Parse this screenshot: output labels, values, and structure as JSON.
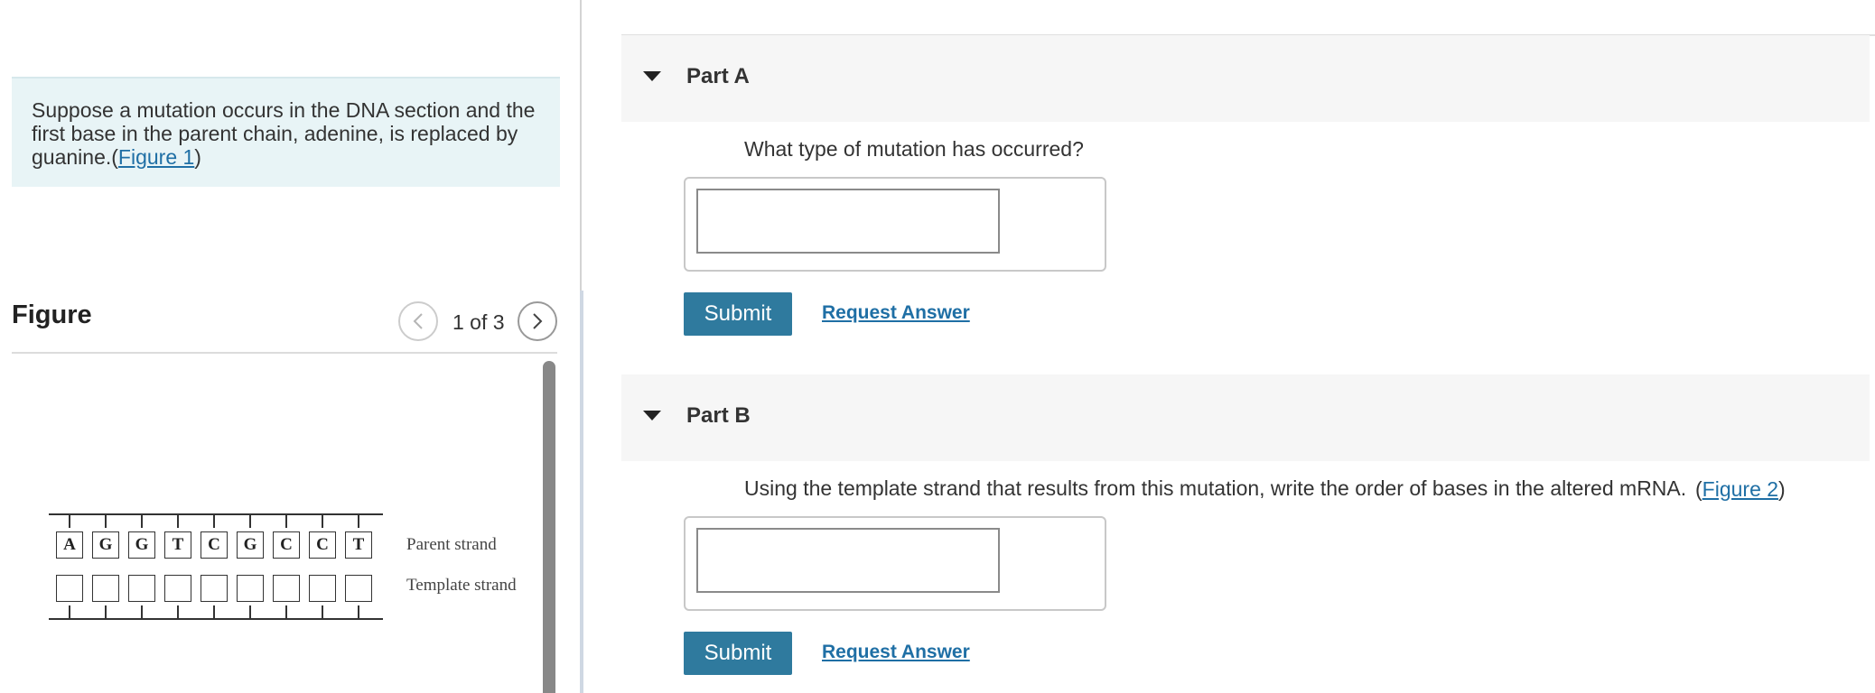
{
  "intro": {
    "text": "Suppose a mutation occurs in the DNA section and the first base in the parent chain, adenine, is replaced by guanine.",
    "figure_link_open": "(",
    "figure_link": "Figure 1",
    "figure_link_close": ")"
  },
  "figure": {
    "title": "Figure",
    "pagination": "1 of 3",
    "parent_bases": [
      "A",
      "G",
      "G",
      "T",
      "C",
      "G",
      "C",
      "C",
      "T"
    ],
    "parent_label": "Parent strand",
    "template_label": "Template strand"
  },
  "partA": {
    "title": "Part A",
    "question": "What type of mutation has occurred?",
    "submit_label": "Submit",
    "request_label": "Request Answer"
  },
  "partB": {
    "title": "Part B",
    "question": "Using the template strand that results from this mutation, write the order of bases in the altered mRNA.",
    "figure_ref_open": "(",
    "figure_ref": "Figure 2",
    "figure_ref_close": ")",
    "submit_label": "Submit",
    "request_label": "Request Answer"
  },
  "colors": {
    "accent": "#2f7a9e",
    "link": "#1f6fa5",
    "intro_bg": "#e8f4f6",
    "part_header_bg": "#f6f6f6"
  },
  "icons": {
    "prev": "chevron-left-icon",
    "next": "chevron-right-icon",
    "collapse": "caret-down-icon"
  }
}
